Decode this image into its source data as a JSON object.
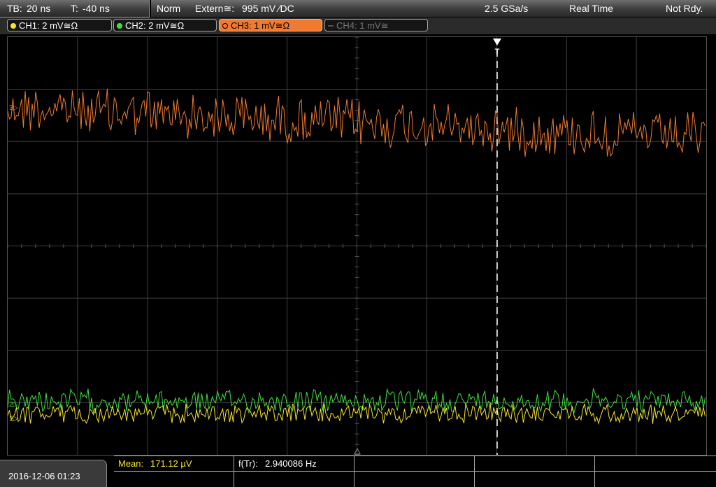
{
  "header": {
    "tb_label": "TB:",
    "tb_value": "20 ns",
    "t_label": "T:",
    "t_value": "-40 ns",
    "mode": "Norm",
    "trigger_label": "Extern≅:",
    "trigger_value": "995 mV ⁄DC",
    "sample_rate": "2.5 GSa/s",
    "acq_mode": "Real Time",
    "status": "Not Rdy."
  },
  "channels": [
    {
      "label": "CH1: 2 mV≅Ω",
      "color": "#f0e020",
      "active": true
    },
    {
      "label": "CH2: 2 mV≅Ω",
      "color": "#40d040",
      "active": true
    },
    {
      "label": "CH3: 1 mV≅Ω",
      "color": "#f07a30",
      "active": true,
      "selected": true
    },
    {
      "label": "CH4: 1 mV≅",
      "color": "#777777",
      "active": false
    }
  ],
  "markers": {
    "ch3": "3▷",
    "ch2": "2▷",
    "ch1": "1▷",
    "trigger": "T"
  },
  "measurements": {
    "mean_label": "Mean:",
    "mean_value": "171.12 µV",
    "freq_label": "f(Tr):",
    "freq_value": "2.940086 Hz"
  },
  "datetime": "2016-12-06 01:23",
  "colors": {
    "ch1": "#f5e52a",
    "ch2": "#3ee03e",
    "ch3": "#f07a30",
    "grid": "#4a4a4a"
  }
}
